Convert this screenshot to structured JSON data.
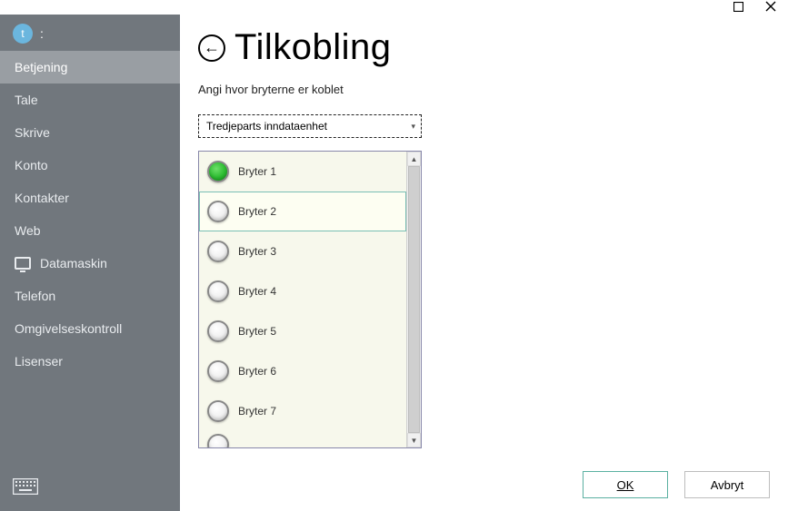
{
  "titlebar": {
    "maximize_icon": "maximize",
    "close_icon": "close"
  },
  "sidebar": {
    "avatar_letter": "t",
    "items": [
      {
        "label": "Betjening",
        "active": true
      },
      {
        "label": "Tale"
      },
      {
        "label": "Skrive"
      },
      {
        "label": "Konto"
      },
      {
        "label": "Kontakter"
      },
      {
        "label": "Web"
      },
      {
        "label": "Datamaskin",
        "icon": "monitor"
      },
      {
        "label": "Telefon"
      },
      {
        "label": "Omgivelseskontroll"
      },
      {
        "label": "Lisenser"
      }
    ]
  },
  "main": {
    "title": "Tilkobling",
    "subtitle": "Angi hvor bryterne er koblet",
    "dropdown": {
      "selected": "Tredjeparts inndataenhet"
    },
    "switches": [
      {
        "label": "Bryter 1",
        "on": true
      },
      {
        "label": "Bryter 2",
        "selected": true
      },
      {
        "label": "Bryter 3"
      },
      {
        "label": "Bryter 4"
      },
      {
        "label": "Bryter 5"
      },
      {
        "label": "Bryter 6"
      },
      {
        "label": "Bryter 7"
      }
    ]
  },
  "footer": {
    "ok": "OK",
    "cancel": "Avbryt"
  }
}
